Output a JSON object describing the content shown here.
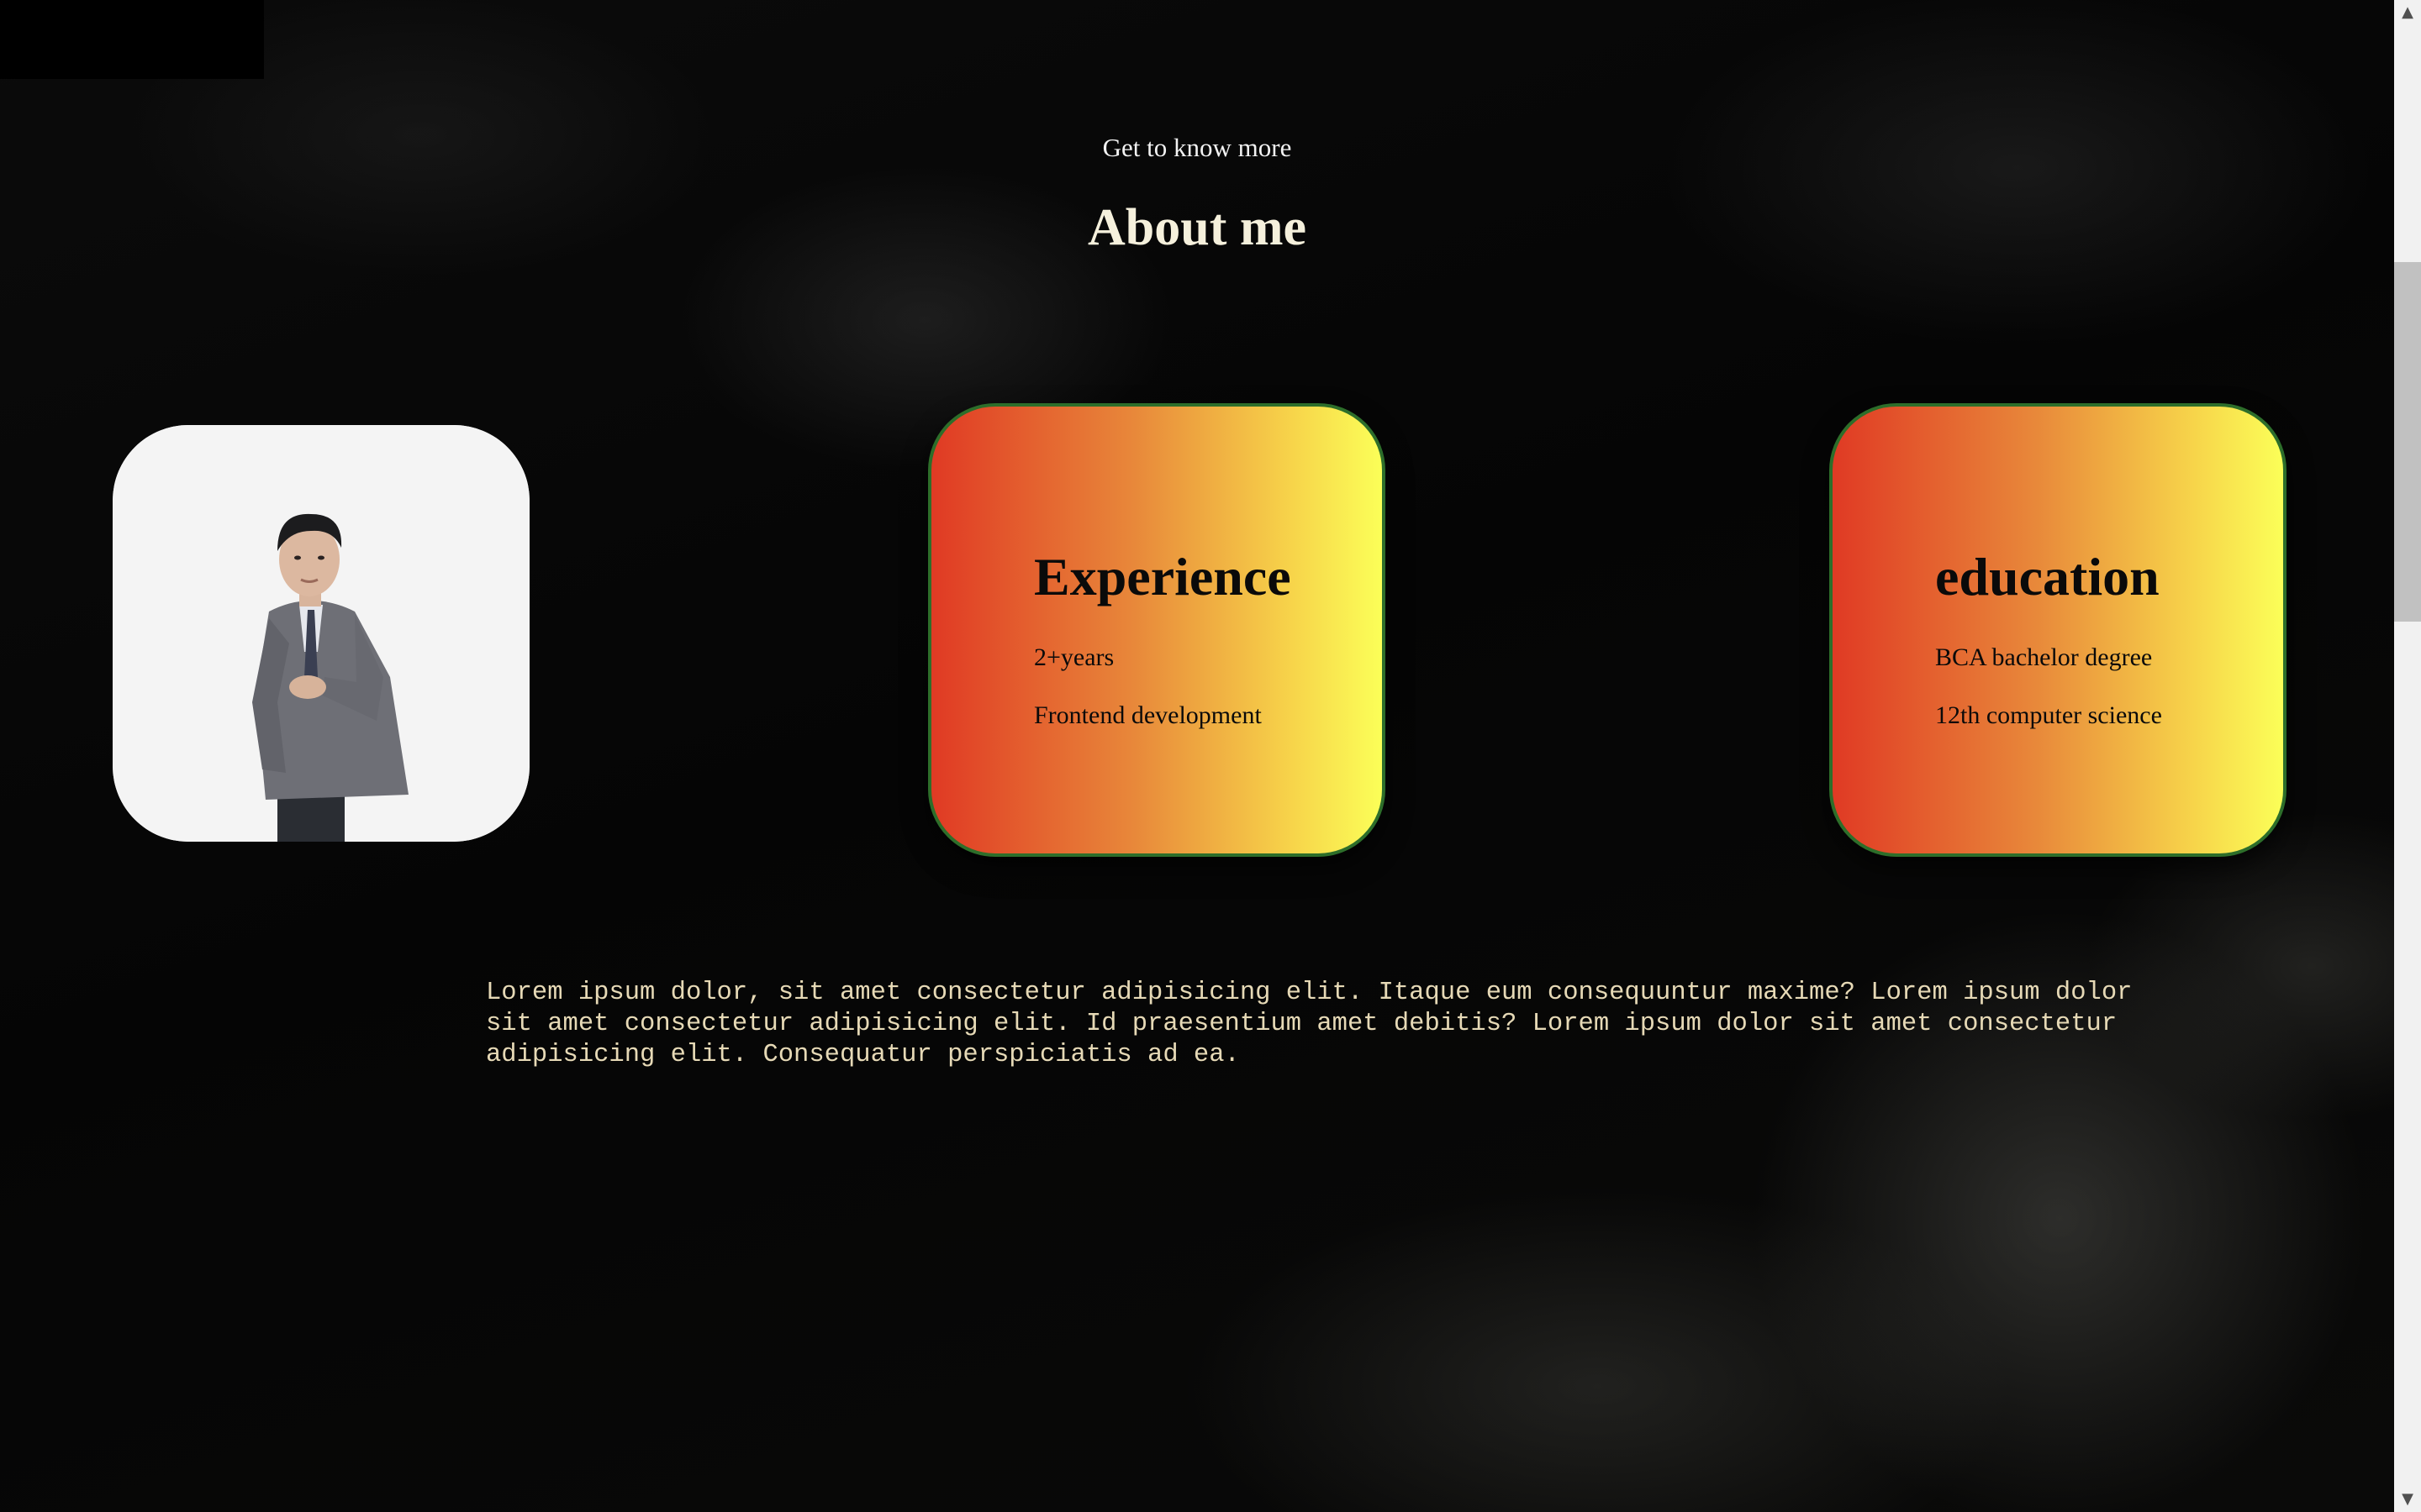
{
  "about": {
    "intro": "Get to know more",
    "title": "About me",
    "profile_image": "person-in-gray-suit-portrait"
  },
  "cards": {
    "experience": {
      "title": "Experience",
      "line1": "2+years",
      "line2": "Frontend development"
    },
    "education": {
      "title": "education",
      "line1": "BCA bachelor degree",
      "line2": "12th computer science"
    }
  },
  "bio": "Lorem ipsum dolor, sit amet consectetur adipisicing elit. Itaque eum consequuntur maxime? Lorem ipsum dolor sit amet consectetur adipisicing elit. Id praesentium amet debitis? Lorem ipsum dolor sit amet consectetur adipisicing elit. Consequatur perspiciatis ad ea.",
  "scrollbar": {
    "up_arrow": "▲",
    "down_arrow": "▼"
  },
  "colors": {
    "card_gradient_start": "#e03a24",
    "card_gradient_end": "#fbff58",
    "card_border": "#2d6e2a",
    "bio_text": "#e6d9b6",
    "title_text": "#f5f0dc"
  }
}
